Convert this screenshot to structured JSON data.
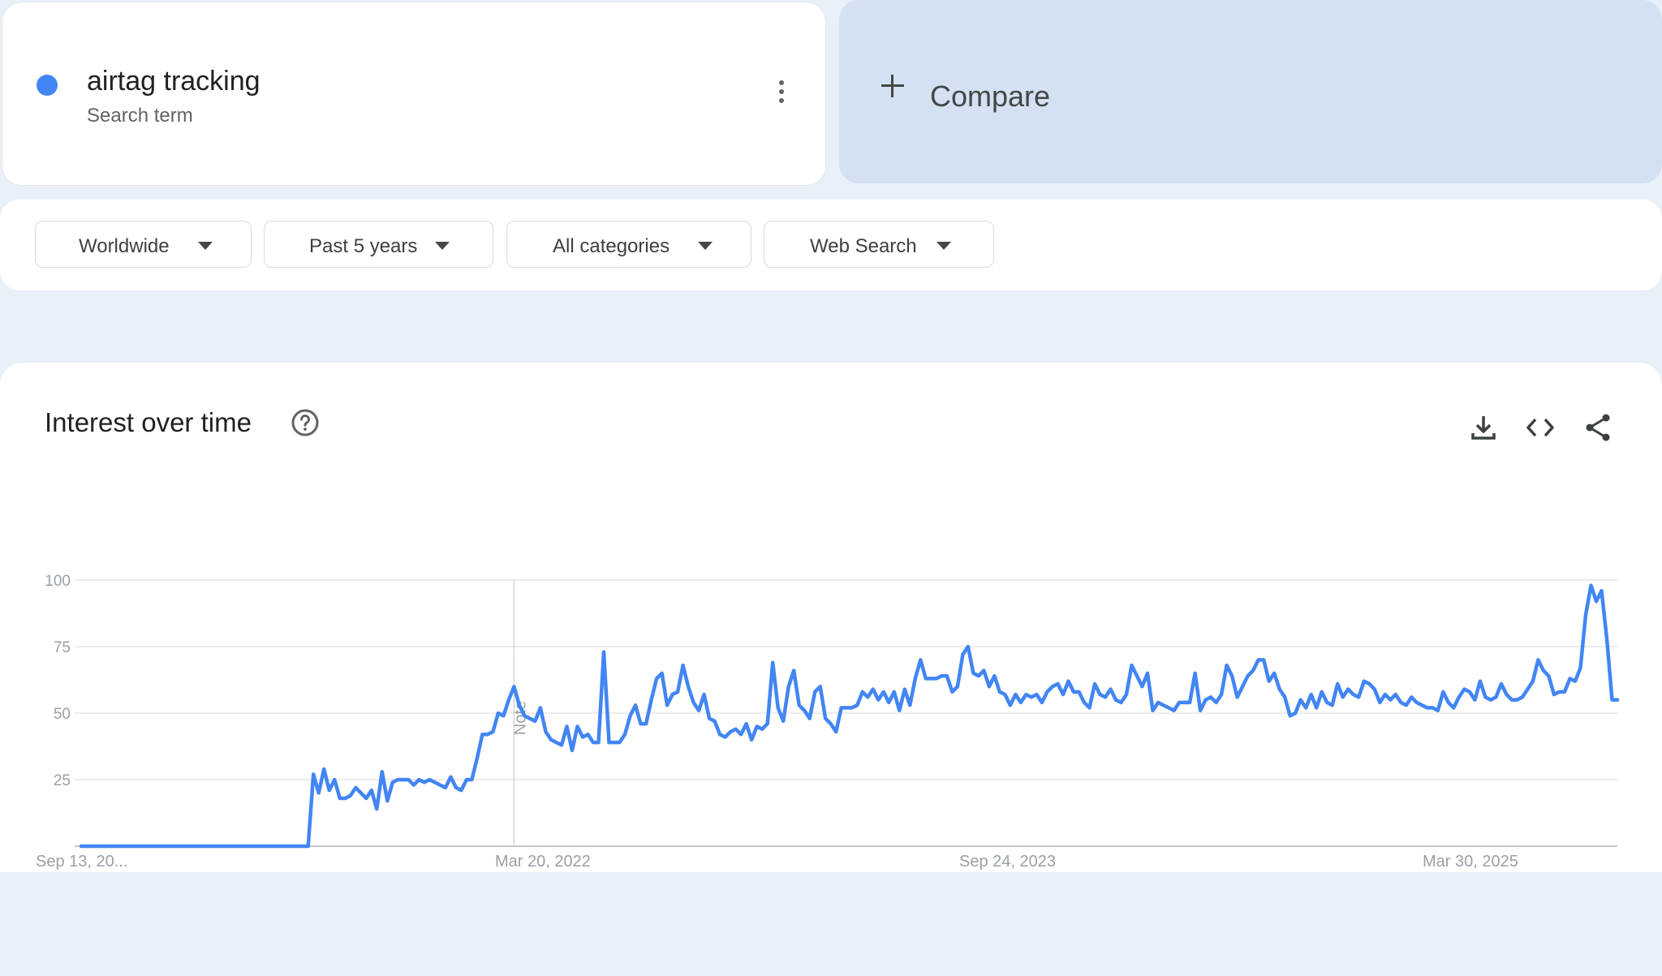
{
  "search_term": {
    "name": "airtag tracking",
    "type": "Search term",
    "color": "#4285f4"
  },
  "compare": {
    "label": "Compare"
  },
  "filters": {
    "region": "Worldwide",
    "time_range": "Past 5 years",
    "category": "All categories",
    "property": "Web Search"
  },
  "panel": {
    "title": "Interest over time",
    "icons": [
      "help-icon",
      "download-icon",
      "embed-icon",
      "share-icon"
    ]
  },
  "chart_data": {
    "type": "line",
    "title": "Interest over time",
    "annotation": "Note",
    "x_tick_labels": [
      "Sep 13, 20...",
      "Mar 20, 2022",
      "Sep 24, 2023",
      "Mar 30, 2025"
    ],
    "y_ticks": [
      25,
      50,
      75,
      100
    ],
    "ylim": [
      0,
      100
    ],
    "grid": true,
    "series": [
      {
        "color": "#4285f4",
        "values": [
          0,
          0,
          0,
          0,
          0,
          0,
          0,
          0,
          0,
          0,
          0,
          0,
          0,
          0,
          0,
          0,
          0,
          0,
          0,
          0,
          0,
          0,
          0,
          0,
          0,
          0,
          0,
          0,
          0,
          0,
          0,
          0,
          0,
          0,
          0,
          0,
          0,
          0,
          0,
          0,
          0,
          0,
          0,
          0,
          27,
          20,
          29,
          21,
          25,
          18,
          18,
          19,
          22,
          20,
          18,
          21,
          14,
          28,
          17,
          24,
          25,
          25,
          25,
          23,
          25,
          24,
          25,
          24,
          23,
          22,
          26,
          22,
          21,
          25,
          25,
          33,
          42,
          42,
          43,
          50,
          49,
          55,
          60,
          53,
          49,
          48,
          47,
          52,
          43,
          40,
          39,
          38,
          45,
          36,
          45,
          41,
          42,
          39,
          39,
          73,
          39,
          39,
          39,
          42,
          49,
          53,
          46,
          46,
          55,
          63,
          65,
          53,
          57,
          58,
          68,
          60,
          54,
          51,
          57,
          48,
          47,
          42,
          41,
          43,
          44,
          42,
          46,
          40,
          45,
          44,
          46,
          69,
          52,
          47,
          60,
          66,
          53,
          51,
          48,
          58,
          60,
          48,
          46,
          43,
          52,
          52,
          52,
          53,
          58,
          56,
          59,
          55,
          58,
          54,
          58,
          51,
          59,
          53,
          63,
          70,
          63,
          63,
          63,
          64,
          64,
          58,
          60,
          72,
          75,
          65,
          64,
          66,
          60,
          64,
          58,
          57,
          53,
          57,
          54,
          57,
          56,
          57,
          54,
          58,
          60,
          61,
          57,
          62,
          58,
          58,
          54,
          52,
          61,
          57,
          56,
          59,
          55,
          54,
          57,
          68,
          64,
          60,
          65,
          51,
          54,
          53,
          52,
          51,
          54,
          54,
          54,
          65,
          51,
          55,
          56,
          54,
          57,
          68,
          64,
          56,
          60,
          64,
          66,
          70,
          70,
          62,
          65,
          59,
          56,
          49,
          50,
          55,
          52,
          57,
          52,
          58,
          54,
          53,
          61,
          56,
          59,
          57,
          56,
          62,
          61,
          59,
          54,
          57,
          55,
          57,
          54,
          53,
          56,
          54,
          53,
          52,
          52,
          51,
          58,
          54,
          52,
          56,
          59,
          58,
          55,
          62,
          56,
          55,
          56,
          61,
          57,
          55,
          55,
          56,
          59,
          62,
          70,
          66,
          64,
          57,
          58,
          58,
          63,
          62,
          67,
          87,
          98,
          92,
          96,
          78,
          55,
          55
        ]
      }
    ]
  }
}
